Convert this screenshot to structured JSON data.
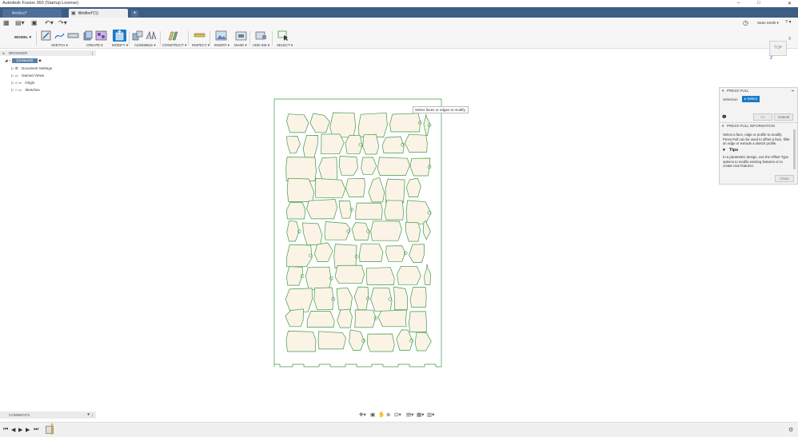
{
  "app": {
    "title": "Autodesk Fusion 360 (Startup License)",
    "window_controls": [
      "–",
      "□",
      "✕"
    ]
  },
  "tabs": [
    {
      "label": "Untitled*"
    },
    {
      "label": "Untitled*(1)"
    }
  ],
  "qat": {
    "user": "Sean Smith ▾",
    "help": "? ▾"
  },
  "ribbon": {
    "workspace": "MODEL ▾",
    "groups": [
      {
        "label": "SKETCH ▾"
      },
      {
        "label": "CREATE ▾"
      },
      {
        "label": "MODIFY ▾"
      },
      {
        "label": "ASSEMBLE ▾"
      },
      {
        "label": "CONSTRUCT ▾"
      },
      {
        "label": "INSPECT ▾"
      },
      {
        "label": "INSERT ▾"
      },
      {
        "label": "MAKE ▾"
      },
      {
        "label": "ADD-INS ▾"
      },
      {
        "label": "SELECT ▾"
      }
    ]
  },
  "browser": {
    "header": "BROWSER",
    "root": "(Unsaved)",
    "items": [
      {
        "label": "Document Settings"
      },
      {
        "label": "Named Views"
      },
      {
        "label": "Origin"
      },
      {
        "label": "Sketches"
      }
    ]
  },
  "viewcube": {
    "face": "TOP",
    "x_axis": "X",
    "z_axis": "Z"
  },
  "tooltip": "Select faces or edges to modify.",
  "press_pull": {
    "title": "PRESS PULL",
    "selection_label": "Selection",
    "select_button": "Select",
    "ok": "OK",
    "cancel": "Cancel",
    "info_title": "PRESS PULL INFORMATION",
    "info_text": "Select a face, edge or profile to modify. Press Pull can be used to offset a face, fillet an edge or extrude a sketch profile.",
    "tips_title": "Tips",
    "tips_text": "In a parametric design, use the Offset Type options to modify existing features or to create new features.",
    "close": "Close"
  },
  "comments": {
    "label": "COMMENTS"
  },
  "colors": {
    "tabbar": "#3d5d84",
    "sketch_line": "#3f9a4a",
    "profile_fill": "#fbf3e6",
    "select_blue": "#1a7ac9"
  }
}
